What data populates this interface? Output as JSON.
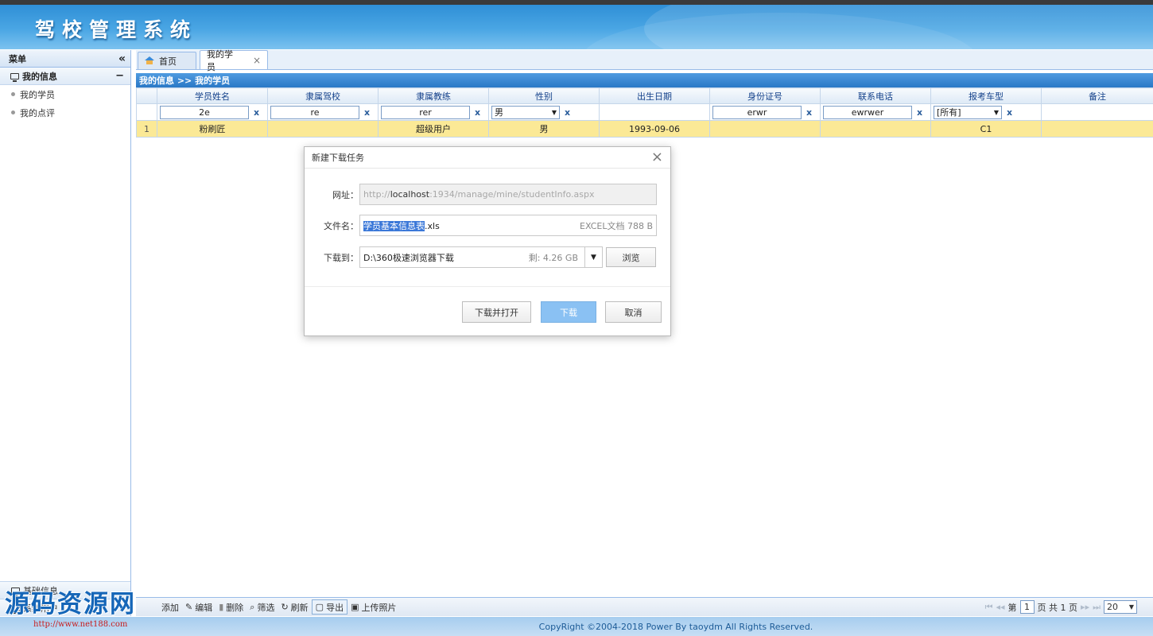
{
  "app": {
    "title": "驾校管理系统"
  },
  "sidebar": {
    "header": "菜单",
    "collapse_glyph": "«",
    "group": {
      "label": "我的信息",
      "toggle": "−"
    },
    "items": [
      {
        "label": "我的学员"
      },
      {
        "label": "我的点评"
      }
    ],
    "bottom": [
      {
        "label": "基础信息"
      },
      {
        "label": "系统用户"
      }
    ]
  },
  "tabs": [
    {
      "label": "首页"
    },
    {
      "label": "我的学员",
      "close": "×"
    }
  ],
  "breadcrumb": "我的信息 >> 我的学员",
  "grid": {
    "columns": [
      "学员姓名",
      "隶属驾校",
      "隶属教练",
      "性别",
      "出生日期",
      "身份证号",
      "联系电话",
      "报考车型",
      "备注"
    ],
    "filters": {
      "name": "2e",
      "school": "re",
      "coach": "rer",
      "gender": "男",
      "idcard": "erwr",
      "phone": "ewrwer",
      "car_type": "[所有]",
      "clear": "x",
      "arrow": "▼"
    },
    "rows": [
      {
        "num": "1",
        "name": "粉刷匠",
        "school": "",
        "coach": "超级用户",
        "gender": "男",
        "birth": "1993-09-06",
        "idcard": "",
        "phone": "",
        "car_type": "C1",
        "remark": ""
      }
    ]
  },
  "toolbar": {
    "buttons": [
      {
        "label": "添加"
      },
      {
        "label": "编辑"
      },
      {
        "label": "删除"
      },
      {
        "label": "筛选"
      },
      {
        "label": "刷新"
      },
      {
        "label": "导出"
      },
      {
        "label": "上传照片"
      }
    ],
    "pager": {
      "prefix": "第",
      "page": "1",
      "of": "页 共 1 页",
      "page_size": "20"
    }
  },
  "footer": "CopyRight ©2004-2018 Power By taoydm   All Rights Reserved.",
  "dialog": {
    "title": "新建下载任务",
    "close": "×",
    "url_label": "网址：",
    "url_prefix": "http://",
    "url_host": "localhost",
    "url_rest": ":1934/manage/mine/studentInfo.aspx",
    "filename_label": "文件名：",
    "filename_selected": "学员基本信息表",
    "filename_ext": ".xls",
    "file_meta": "EXCEL文档 788 B",
    "saveto_label": "下载到：",
    "save_path": "D:\\360极速浏览器下载",
    "free_space": "剩: 4.26 GB",
    "browse": "浏览",
    "btn_download_open": "下载并打开",
    "btn_download": "下载",
    "btn_cancel": "取消"
  },
  "watermark": {
    "text": "源码资源网",
    "url": "http://www.net188.com"
  }
}
